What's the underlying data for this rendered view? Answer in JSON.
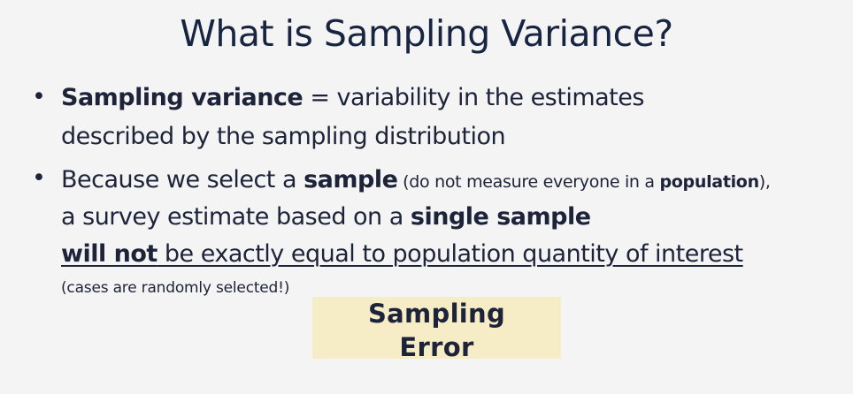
{
  "slide": {
    "title": "What is Sampling Variance?",
    "bullet_symbol": "•",
    "bullets": [
      {
        "line1": {
          "term": "Sampling variance",
          "rest": " = variability in the estimates"
        },
        "line2": "described by the sampling distribution"
      },
      {
        "line1": {
          "lead": "Because we select a ",
          "sample": "sample",
          "paren_open": " (do not measure everyone in a ",
          "population": "population",
          "paren_close": "),"
        },
        "line2": {
          "lead": "a survey estimate based on a ",
          "single_sample": "single sample"
        },
        "line3": {
          "will_not": "will not",
          "rest": " be exactly equal to population quantity of interest"
        }
      }
    ],
    "note": "(cases are randomly selected!)",
    "highlight": {
      "line1": "Sampling",
      "line2": "Error",
      "background_color": "#f6ecc6"
    }
  }
}
